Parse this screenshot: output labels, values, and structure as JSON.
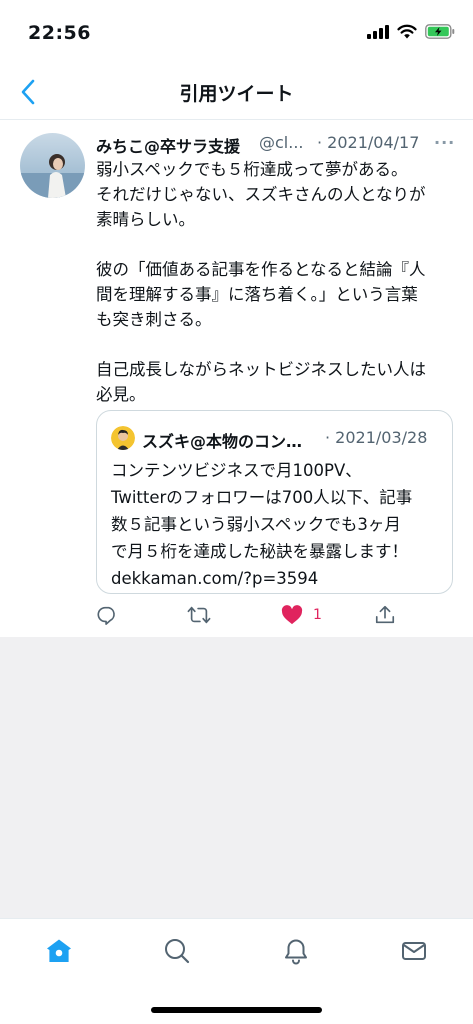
{
  "status": {
    "time": "22:56"
  },
  "nav": {
    "title": "引用ツイート",
    "back_icon": "chevron-left-icon"
  },
  "tweet": {
    "author_name": "みちこ@卒サラ支援",
    "author_handle": "@cl...",
    "date": "· 2021/04/17",
    "more_icon": "···",
    "body_lines": [
      "弱小スペックでも５桁達成って夢がある。",
      "それだけじゃない、スズキさんの人となりが",
      "素晴らしい。",
      "彼の「価値ある記事を作るとなると結論『人",
      "間を理解する事』に落ち着く。」という言葉",
      "も突き刺さる。",
      "自己成長しながらネットビジネスしたい人は",
      "必見。"
    ],
    "quote": {
      "author_name": "スズキ@本物のコン…",
      "date": "· 2021/03/28",
      "body_lines": [
        "コンテンツビジネスで月100PV、",
        "Twitterのフォロワーは700人以下、記事",
        "数５記事という弱小スペックでも3ヶ月",
        "で月５桁を達成した秘訣を暴露します！",
        "dekkaman.com/?p=3594"
      ]
    },
    "actions": {
      "reply_icon": "reply-icon",
      "retweet_icon": "retweet-icon",
      "like_icon": "heart-filled-icon",
      "like_count": "1",
      "share_icon": "share-icon"
    }
  },
  "tabs": [
    {
      "name": "home",
      "icon": "home-icon",
      "active": true
    },
    {
      "name": "search",
      "icon": "search-icon",
      "active": false
    },
    {
      "name": "notifications",
      "icon": "bell-icon",
      "active": false
    },
    {
      "name": "messages",
      "icon": "mail-icon",
      "active": false
    }
  ],
  "colors": {
    "accent": "#1da1f2",
    "like": "#e0245e",
    "text": "#0f1419",
    "muted": "#536471",
    "icon_grey": "#536471",
    "border": "#cfd9de",
    "empty_area": "#f0f0f2"
  }
}
